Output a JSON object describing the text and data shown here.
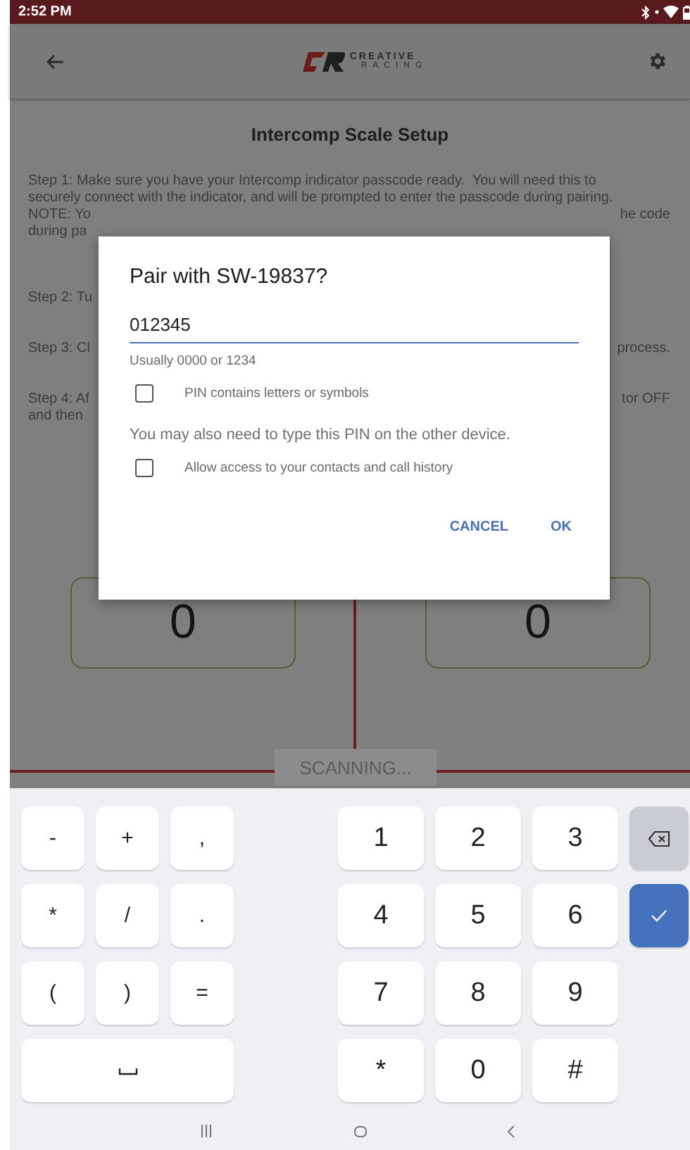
{
  "status_bar": {
    "time": "2:52 PM"
  },
  "app_bar": {
    "logo_words": [
      "CREATIVE",
      "RACING"
    ]
  },
  "page": {
    "title": "Intercomp Scale Setup",
    "step_1": "Step 1: Make sure you have your Intercomp indicator passcode ready.  You will need this to securely connect with the indicator, and will be prompted to enter the passcode during pairing.",
    "paragraphs": [
      {
        "lines": [
          {
            "left": "NOTE: Yo",
            "right": "he code"
          },
          {
            "left": "during pa"
          }
        ]
      },
      {
        "lines": [
          {
            "left": "Step 2: Tu"
          }
        ]
      },
      {
        "lines": [
          {
            "left": "Step 3: Cl",
            "right": "process."
          }
        ]
      },
      {
        "lines": [
          {
            "left": "Step 4: Af",
            "right": "tor OFF"
          },
          {
            "left": "and then"
          }
        ]
      }
    ],
    "readouts": [
      "0",
      "0"
    ],
    "scan_button": "SCANNING..."
  },
  "dialog": {
    "title": "Pair with SW-19837?",
    "pin_field": {
      "value": "012345"
    },
    "hint": "Usually 0000 or 1234",
    "items": [
      {
        "kind": "checkbox",
        "label": "PIN contains letters or symbols",
        "checked": false
      },
      {
        "kind": "note",
        "label": "You may also need to type this PIN on the other device."
      },
      {
        "kind": "checkbox",
        "label": "Allow access to your contacts and call history",
        "checked": false
      }
    ],
    "buttons": [
      "CANCEL",
      "OK"
    ]
  },
  "keyboard": {
    "rows": [
      {
        "left": [
          {
            "kind": "char",
            "label": "-"
          },
          {
            "kind": "char",
            "label": "+"
          },
          {
            "kind": "char",
            "label": ","
          }
        ],
        "right": [
          {
            "kind": "char",
            "label": "1"
          },
          {
            "kind": "char",
            "label": "2"
          },
          {
            "kind": "char",
            "label": "3"
          },
          {
            "kind": "backspace"
          }
        ]
      },
      {
        "left": [
          {
            "kind": "char",
            "label": "*"
          },
          {
            "kind": "char",
            "label": "/"
          },
          {
            "kind": "char",
            "label": "."
          }
        ],
        "right": [
          {
            "kind": "char",
            "label": "4"
          },
          {
            "kind": "char",
            "label": "5"
          },
          {
            "kind": "char",
            "label": "6"
          },
          {
            "kind": "done"
          }
        ]
      },
      {
        "left": [
          {
            "kind": "char",
            "label": "("
          },
          {
            "kind": "char",
            "label": ")"
          },
          {
            "kind": "char",
            "label": "="
          }
        ],
        "right": [
          {
            "kind": "char",
            "label": "7"
          },
          {
            "kind": "char",
            "label": "8"
          },
          {
            "kind": "char",
            "label": "9"
          }
        ]
      },
      {
        "left": [
          {
            "kind": "space"
          }
        ],
        "right": [
          {
            "kind": "char",
            "label": "*"
          },
          {
            "kind": "char",
            "label": "0"
          },
          {
            "kind": "char",
            "label": "#"
          }
        ]
      }
    ]
  }
}
